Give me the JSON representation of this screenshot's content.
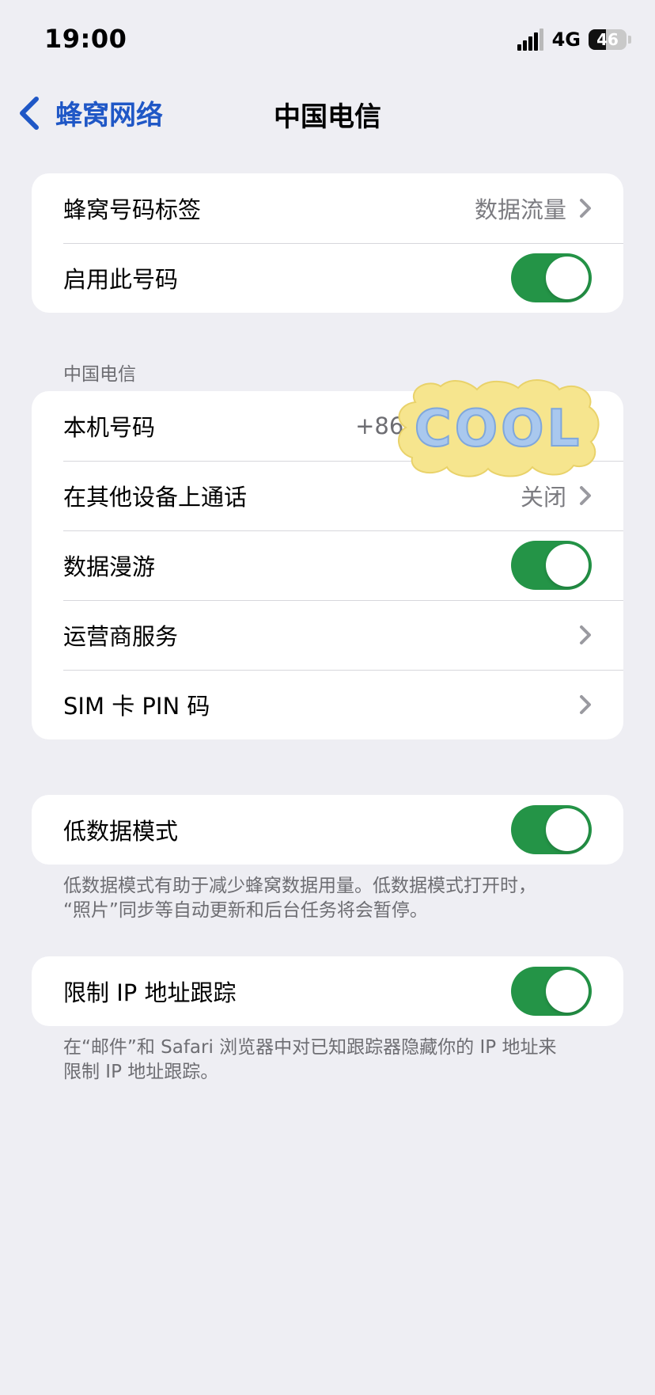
{
  "status_bar": {
    "time": "19:00",
    "network": "4G",
    "battery": "46",
    "battery_level": 0.46
  },
  "nav": {
    "back_label": "蜂窝网络",
    "title": "中国电信"
  },
  "group1": {
    "label_row": {
      "label": "蜂窝号码标签",
      "value": "数据流量"
    },
    "enable_row": {
      "label": "启用此号码",
      "toggle_on": true
    }
  },
  "group2": {
    "header": "中国电信",
    "number_row": {
      "label": "本机号码",
      "value": "+86 1"
    },
    "other_devices_row": {
      "label": "在其他设备上通话",
      "value": "关闭"
    },
    "roaming_row": {
      "label": "数据漫游",
      "toggle_on": true
    },
    "carrier_row": {
      "label": "运营商服务"
    },
    "sim_pin_row": {
      "label": "SIM 卡 PIN 码"
    }
  },
  "group3": {
    "low_data_row": {
      "label": "低数据模式",
      "toggle_on": true
    },
    "footnote_line1": "低数据模式有助于减少蜂窝数据用量。低数据模式打开时，",
    "footnote_line2": "“照片”同步等自动更新和后台任务将会暂停。"
  },
  "group4": {
    "ip_row": {
      "label": "限制 IP 地址跟踪",
      "toggle_on": true
    },
    "footnote_line1": "在“邮件”和 Safari 浏览器中对已知跟踪器隐藏你的 IP 地址来",
    "footnote_line2": "限制 IP 地址跟踪。"
  },
  "sticker": {
    "text": "COOL"
  },
  "colors": {
    "accent": "#1f57c6",
    "toggle_on": "#249447",
    "background": "#eeeef3"
  },
  "icons": [
    "signal-icon",
    "battery-icon",
    "chevron-left-icon",
    "chevron-right-icon",
    "toggle-switch"
  ]
}
